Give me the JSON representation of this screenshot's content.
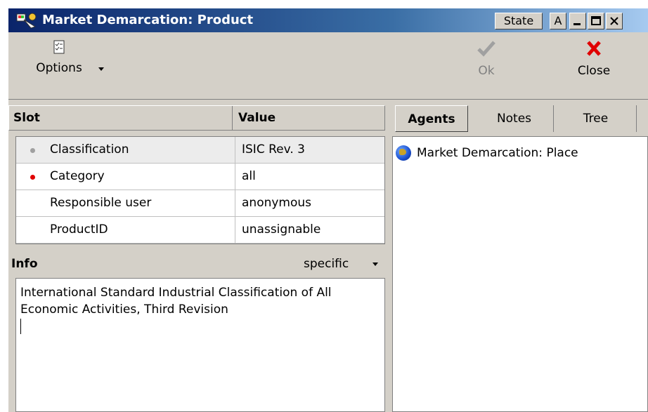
{
  "window": {
    "title": "Market Demarcation: Product",
    "buttons": {
      "state": "State",
      "a": "A",
      "minimize": "_",
      "maximize": "☐",
      "close": "×"
    }
  },
  "toolbar": {
    "options_label": "Options",
    "ok_label": "Ok",
    "close_label": "Close"
  },
  "slots": {
    "headers": {
      "slot": "Slot",
      "value": "Value"
    },
    "rows": [
      {
        "slot": "Classification",
        "value": "ISIC Rev. 3",
        "marker": "grey"
      },
      {
        "slot": "Category",
        "value": "all",
        "marker": "red"
      },
      {
        "slot": "Responsible user",
        "value": "anonymous",
        "marker": ""
      },
      {
        "slot": "ProductID",
        "value": "unassignable",
        "marker": ""
      }
    ]
  },
  "info": {
    "title": "Info",
    "mode": "specific",
    "text": "International Standard Industrial Classification of All Economic Activities, Third Revision"
  },
  "tabs": [
    {
      "label": "Agents",
      "active": true
    },
    {
      "label": "Notes",
      "active": false
    },
    {
      "label": "Tree",
      "active": false
    }
  ],
  "agents": [
    {
      "label": "Market Demarcation: Place",
      "icon": "globe-icon"
    }
  ],
  "colors": {
    "title_gradient_start": "#0a246a",
    "title_gradient_end": "#a6caf0",
    "face": "#d4d0c8",
    "close_red": "#e00000",
    "marker_red": "#e00000"
  }
}
